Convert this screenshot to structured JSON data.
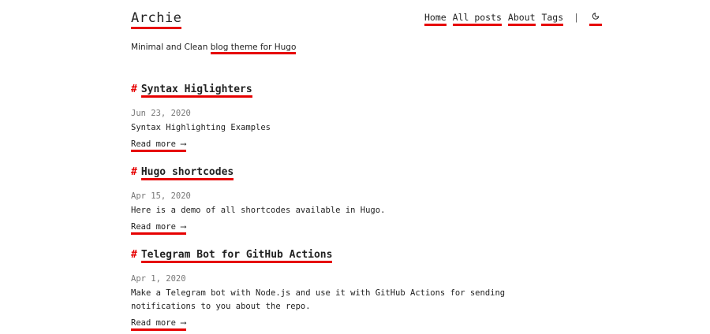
{
  "site": {
    "title": "Archie",
    "tagline_prefix": "Minimal and Clean ",
    "tagline_link": "blog theme for Hugo"
  },
  "nav": {
    "items": [
      {
        "label": "Home"
      },
      {
        "label": "All posts"
      },
      {
        "label": "About"
      },
      {
        "label": "Tags"
      }
    ],
    "separator": "|",
    "theme_toggle_icon": "moon-icon"
  },
  "posts": [
    {
      "hash": "#",
      "title": "Syntax Higlighters",
      "date": "Jun 23, 2020",
      "summary": "Syntax Highlighting Examples",
      "read_more": "Read more ⟶"
    },
    {
      "hash": "#",
      "title": "Hugo shortcodes",
      "date": "Apr 15, 2020",
      "summary": "Here is a demo of all shortcodes available in Hugo.",
      "read_more": "Read more ⟶"
    },
    {
      "hash": "#",
      "title": "Telegram Bot for GitHub Actions",
      "date": "Apr 1, 2020",
      "summary": "Make a Telegram bot with Node.js and use it with GitHub Actions for sending notifications to you about the repo.",
      "read_more": "Read more ⟶"
    }
  ],
  "colors": {
    "accent": "#e60000",
    "text": "#222222",
    "date": "#777777",
    "background": "#ffffff"
  }
}
